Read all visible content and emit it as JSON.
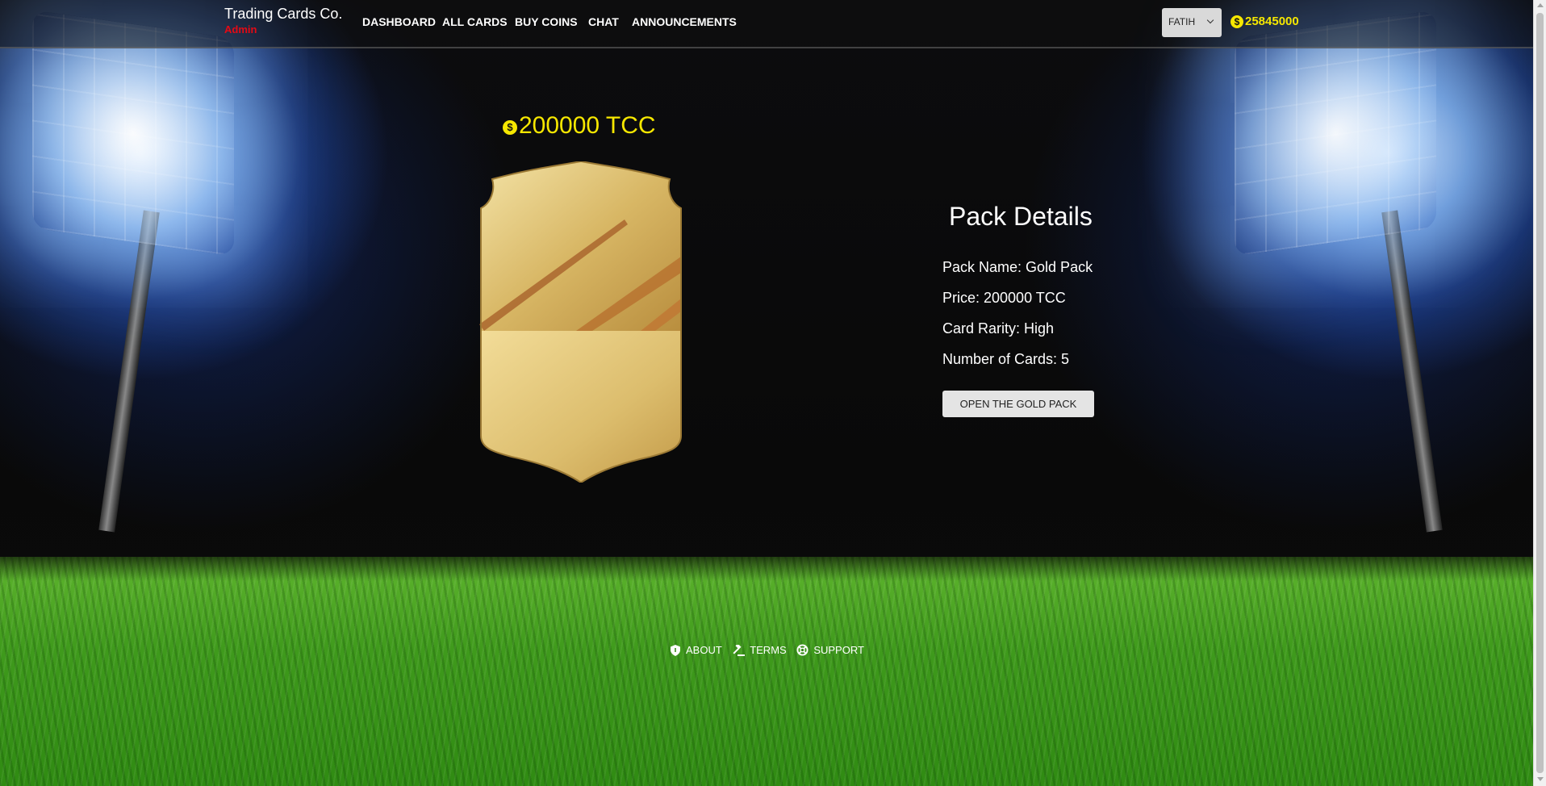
{
  "app": {
    "brand_name": "Trading Cards Co.",
    "role_badge": "Admin"
  },
  "nav": {
    "items": [
      {
        "label": "DASHBOARD"
      },
      {
        "label": "ALL CARDS"
      },
      {
        "label": "BUY COINS"
      },
      {
        "label": "CHAT"
      },
      {
        "label": "ANNOUNCEMENTS"
      }
    ]
  },
  "user": {
    "name": "FATIH",
    "balance": "25845000",
    "coin_icon": "dollar-coin-icon"
  },
  "pack": {
    "price_display": "200000 TCC",
    "details_title": "Pack Details",
    "name_line": "Pack Name: Gold Pack",
    "price_line": "Price: 200000 TCC",
    "rarity_line": "Card Rarity: High",
    "count_line": "Number of Cards: 5",
    "open_button": "OPEN THE GOLD PACK",
    "card_color": "#d9b964"
  },
  "footer": {
    "links": [
      {
        "label": "ABOUT",
        "icon": "shield-icon"
      },
      {
        "label": "TERMS",
        "icon": "gavel-icon"
      },
      {
        "label": "SUPPORT",
        "icon": "lifebuoy-icon"
      }
    ]
  },
  "colors": {
    "accent_yellow": "#f6e700",
    "admin_red": "#e50914"
  }
}
